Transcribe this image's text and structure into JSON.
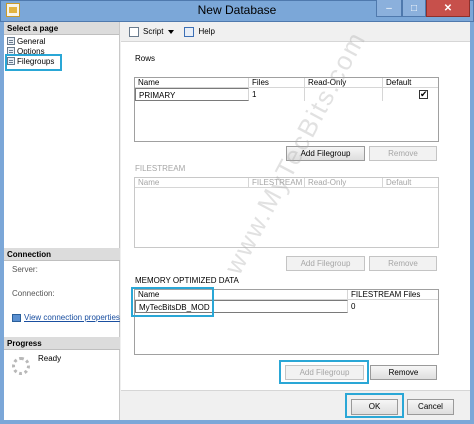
{
  "window": {
    "title": "New Database",
    "minimize_glyph": "–",
    "maximize_glyph": "□",
    "close_glyph": "✕"
  },
  "left_panel": {
    "select_page_heading": "Select a page",
    "pages": [
      {
        "label": "General",
        "icon": "page-icon"
      },
      {
        "label": "Options",
        "icon": "page-icon"
      },
      {
        "label": "Filegroups",
        "icon": "page-icon",
        "selected": true
      }
    ],
    "connection_heading": "Connection",
    "server_label": "Server:",
    "connection_label": "Connection:",
    "view_connection_link": "View connection properties",
    "progress_heading": "Progress",
    "progress_status": "Ready"
  },
  "toolbar": {
    "script_label": "Script",
    "help_label": "Help"
  },
  "rows_section": {
    "label": "Rows",
    "columns": [
      "Name",
      "Files",
      "Read-Only",
      "Default"
    ],
    "rows": [
      {
        "name": "PRIMARY",
        "files": "1",
        "read_only": false,
        "default": true
      }
    ],
    "add_button": "Add Filegroup",
    "remove_button": "Remove"
  },
  "filestream_section": {
    "label": "FILESTREAM",
    "columns": [
      "Name",
      "FILESTREAM ...",
      "Read-Only",
      "Default"
    ],
    "add_button": "Add Filegroup",
    "remove_button": "Remove"
  },
  "memory_section": {
    "label": "MEMORY OPTIMIZED DATA",
    "columns": [
      "Name",
      "FILESTREAM Files"
    ],
    "rows": [
      {
        "name": "MyTecBitsDB_MOD",
        "files": "0"
      }
    ],
    "add_button": "Add Filegroup",
    "remove_button": "Remove"
  },
  "watermark": "www.MyTecBits.com",
  "footer": {
    "ok_button": "OK",
    "cancel_button": "Cancel"
  },
  "colors": {
    "title_bar": "#7ba7d8",
    "highlight": "#2aa7d6",
    "close_button": "#c7504b"
  }
}
